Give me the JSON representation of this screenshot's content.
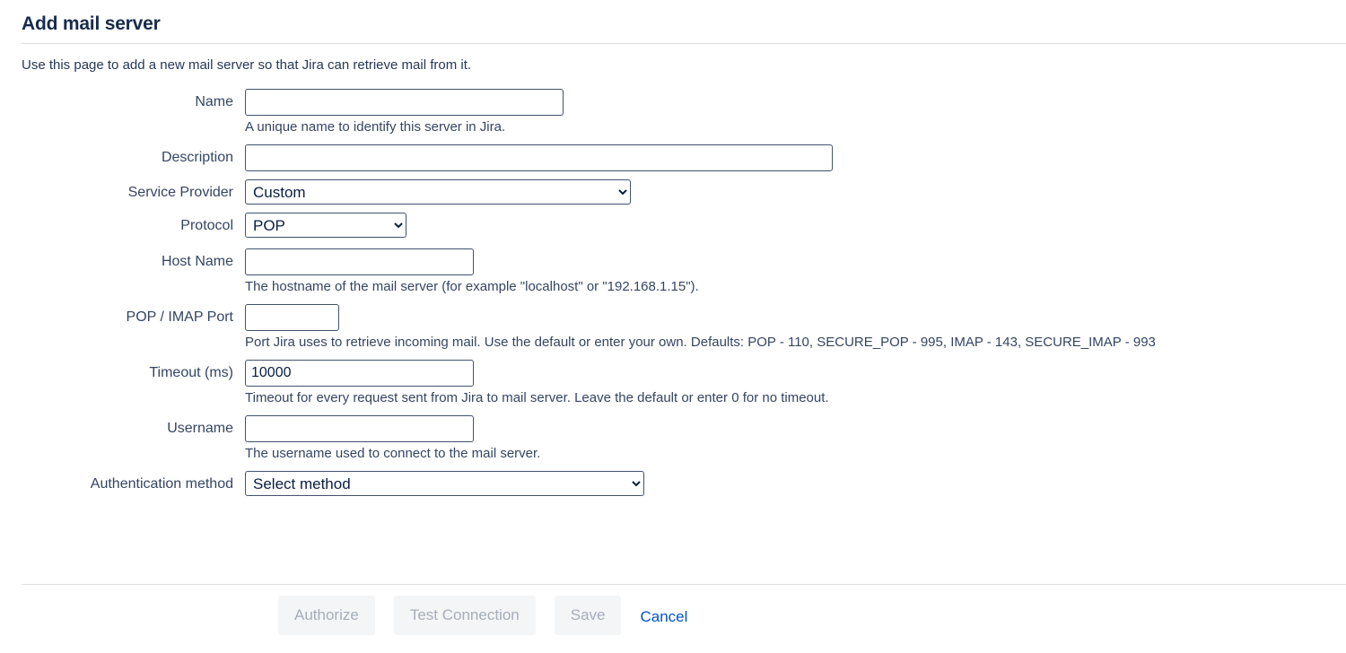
{
  "header": {
    "title": "Add mail server",
    "intro": "Use this page to add a new mail server so that Jira can retrieve mail from it."
  },
  "form": {
    "fields": [
      {
        "id": "name",
        "label": "Name",
        "type": "text",
        "value": "",
        "placeholder": "",
        "help": "A unique name to identify this server in Jira."
      },
      {
        "id": "description",
        "label": "Description",
        "type": "text",
        "value": "",
        "placeholder": "",
        "help": ""
      },
      {
        "id": "service_provider",
        "label": "Service Provider",
        "type": "select",
        "value": "Custom",
        "options": [
          "Custom"
        ],
        "help": ""
      },
      {
        "id": "protocol",
        "label": "Protocol",
        "type": "select",
        "value": "POP",
        "options": [
          "POP"
        ],
        "help": ""
      },
      {
        "id": "host_name",
        "label": "Host Name",
        "type": "text",
        "value": "",
        "placeholder": "",
        "help": "The hostname of the mail server (for example \"localhost\" or \"192.168.1.15\")."
      },
      {
        "id": "port",
        "label": "POP / IMAP Port",
        "type": "text",
        "value": "",
        "placeholder": "",
        "help": "Port Jira uses to retrieve incoming mail. Use the default or enter your own. Defaults: POP - 110, SECURE_POP - 995, IMAP - 143, SECURE_IMAP - 993"
      },
      {
        "id": "timeout",
        "label": "Timeout (ms)",
        "type": "text",
        "value": "10000",
        "placeholder": "",
        "help": "Timeout for every request sent from Jira to mail server. Leave the default or enter 0 for no timeout."
      },
      {
        "id": "username",
        "label": "Username",
        "type": "text",
        "value": "",
        "placeholder": "",
        "help": "The username used to connect to the mail server."
      },
      {
        "id": "auth_method",
        "label": "Authentication method",
        "type": "select",
        "value": "Select method",
        "options": [
          "Select method"
        ],
        "help": ""
      }
    ]
  },
  "footer": {
    "authorize_label": "Authorize",
    "test_connection_label": "Test Connection",
    "save_label": "Save",
    "cancel_label": "Cancel"
  },
  "colors": {
    "title": "#172B4D",
    "text": "#344563",
    "link": "#0052CC",
    "button_bg": "#F4F5F7",
    "button_disabled_text": "#A5ADBA",
    "rule": "#DFE1E6",
    "input_border": "#42526E"
  }
}
